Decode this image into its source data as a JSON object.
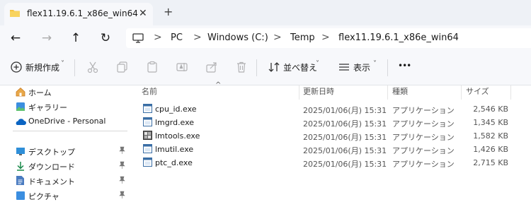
{
  "tab": {
    "title": "flex11.19.6.1_x86e_win64",
    "close": "✕",
    "new_tab": "+"
  },
  "nav": {
    "back": "←",
    "forward": "→",
    "up": "↑",
    "refresh": "↻",
    "breadcrumbs": [
      "PC",
      "Windows (C:)",
      "Temp",
      "flex11.19.6.1_x86e_win64"
    ],
    "separator": ">"
  },
  "toolbar": {
    "new_label": "新規作成",
    "sort_label": "並べ替え",
    "view_label": "表示",
    "more": "•••",
    "chevron": "˅"
  },
  "sidebar": {
    "items": [
      {
        "label": "ホーム",
        "icon": "home-icon"
      },
      {
        "label": "ギャラリー",
        "icon": "gallery-icon"
      },
      {
        "label": "OneDrive - Personal",
        "icon": "onedrive-icon"
      }
    ],
    "quick": [
      {
        "label": "デスクトップ",
        "icon": "desktop-icon",
        "pin": "📌"
      },
      {
        "label": "ダウンロード",
        "icon": "download-icon",
        "pin": "📌"
      },
      {
        "label": "ドキュメント",
        "icon": "document-icon",
        "pin": "📌"
      },
      {
        "label": "ピクチャ",
        "icon": "pictures-icon",
        "pin": "📌"
      }
    ]
  },
  "columns": {
    "name": "名前",
    "modified": "更新日時",
    "type": "種類",
    "size": "サイズ",
    "sort": "^"
  },
  "files": [
    {
      "name": "cpu_id.exe",
      "modified": "2025/01/06(月) 15:31",
      "type": "アプリケーション",
      "size": "2,546 KB"
    },
    {
      "name": "lmgrd.exe",
      "modified": "2025/01/06(月) 15:31",
      "type": "アプリケーション",
      "size": "1,345 KB"
    },
    {
      "name": "lmtools.exe",
      "modified": "2025/01/06(月) 15:31",
      "type": "アプリケーション",
      "size": "1,582 KB"
    },
    {
      "name": "lmutil.exe",
      "modified": "2025/01/06(月) 15:31",
      "type": "アプリケーション",
      "size": "1,426 KB"
    },
    {
      "name": "ptc_d.exe",
      "modified": "2025/01/06(月) 15:31",
      "type": "アプリケーション",
      "size": "2,715 KB"
    }
  ],
  "colors": {
    "folder": "#f4c242",
    "accent": "#0063b1",
    "onedrive": "#0a64c2"
  }
}
